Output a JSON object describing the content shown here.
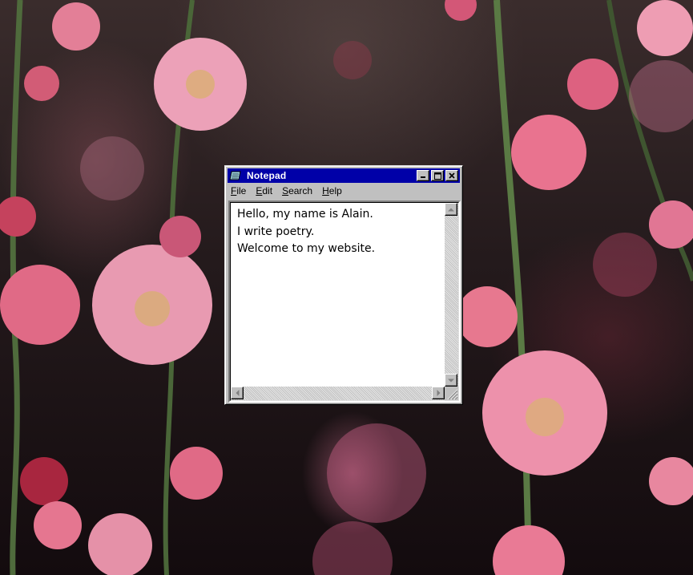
{
  "window": {
    "title": "Notepad",
    "icon": "notepad-icon",
    "controls": [
      "minimize-icon",
      "maximize-icon",
      "close-icon"
    ]
  },
  "menu": {
    "file": {
      "accel": "F",
      "rest": "ile"
    },
    "edit": {
      "accel": "E",
      "rest": "dit"
    },
    "search": {
      "accel": "S",
      "rest": "earch"
    },
    "help": {
      "accel": "H",
      "rest": "elp"
    }
  },
  "document": {
    "lines": [
      "Hello, my name is Alain.",
      "I write poetry.",
      "Welcome to my website."
    ]
  },
  "colors": {
    "titlebar": "#0000a8",
    "window_face": "#c0c0c0"
  }
}
